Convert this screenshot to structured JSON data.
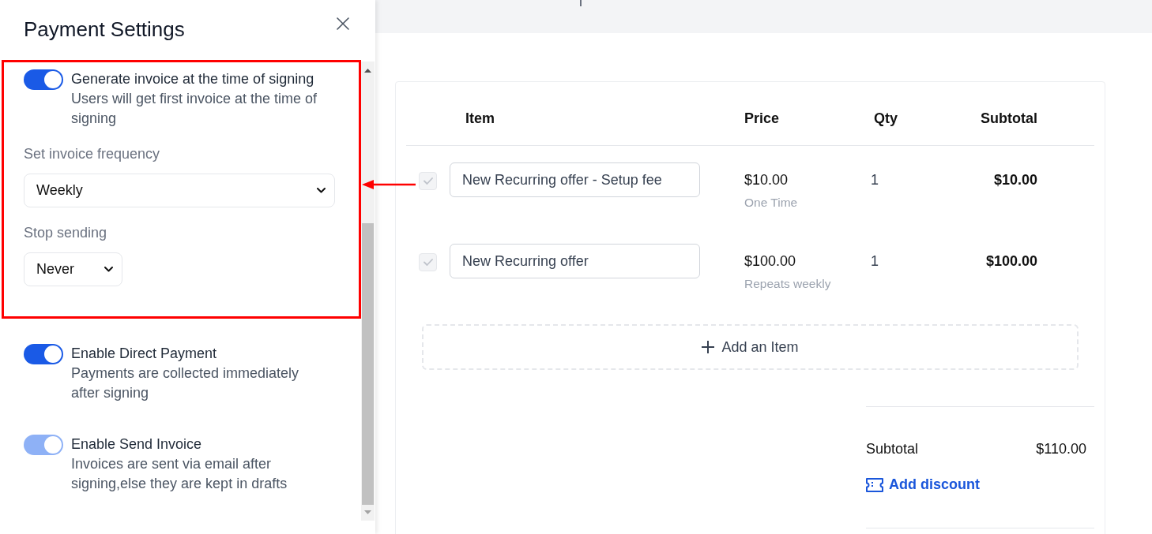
{
  "panel": {
    "title": "Payment Settings",
    "settings": [
      {
        "kind": "toggle",
        "label": "Generate invoice at the time of signing",
        "description": "Users will get first invoice at the time of signing",
        "on": true,
        "disabled": false,
        "highlighted": true,
        "fields": [
          {
            "kind": "select",
            "label": "Set invoice frequency",
            "value": "Weekly"
          },
          {
            "kind": "select",
            "label": "Stop sending",
            "value": "Never"
          }
        ]
      },
      {
        "kind": "toggle",
        "label": "Enable Direct Payment",
        "description": "Payments are collected immediately after signing",
        "on": true,
        "disabled": false,
        "highlighted": false
      },
      {
        "kind": "toggle",
        "label": "Enable Send Invoice",
        "description": "Invoices are sent via email after signing,else they are kept in drafts",
        "on": true,
        "disabled": true,
        "highlighted": false
      }
    ]
  },
  "table": {
    "columns": [
      "Item",
      "Price",
      "Qty",
      "Subtotal"
    ],
    "rows": [
      {
        "checked": true,
        "disabled": true,
        "item": "New Recurring offer - Setup fee",
        "price": "$10.00",
        "billing": "One Time",
        "qty": "1",
        "subtotal": "$10.00"
      },
      {
        "checked": true,
        "disabled": true,
        "item": "New Recurring offer",
        "price": "$100.00",
        "billing": "Repeats weekly",
        "qty": "1",
        "subtotal": "$100.00"
      }
    ],
    "add_item": "Add an Item"
  },
  "summary": {
    "label": "Subtotal",
    "value": "$110.00",
    "discount_link": "Add discount"
  }
}
